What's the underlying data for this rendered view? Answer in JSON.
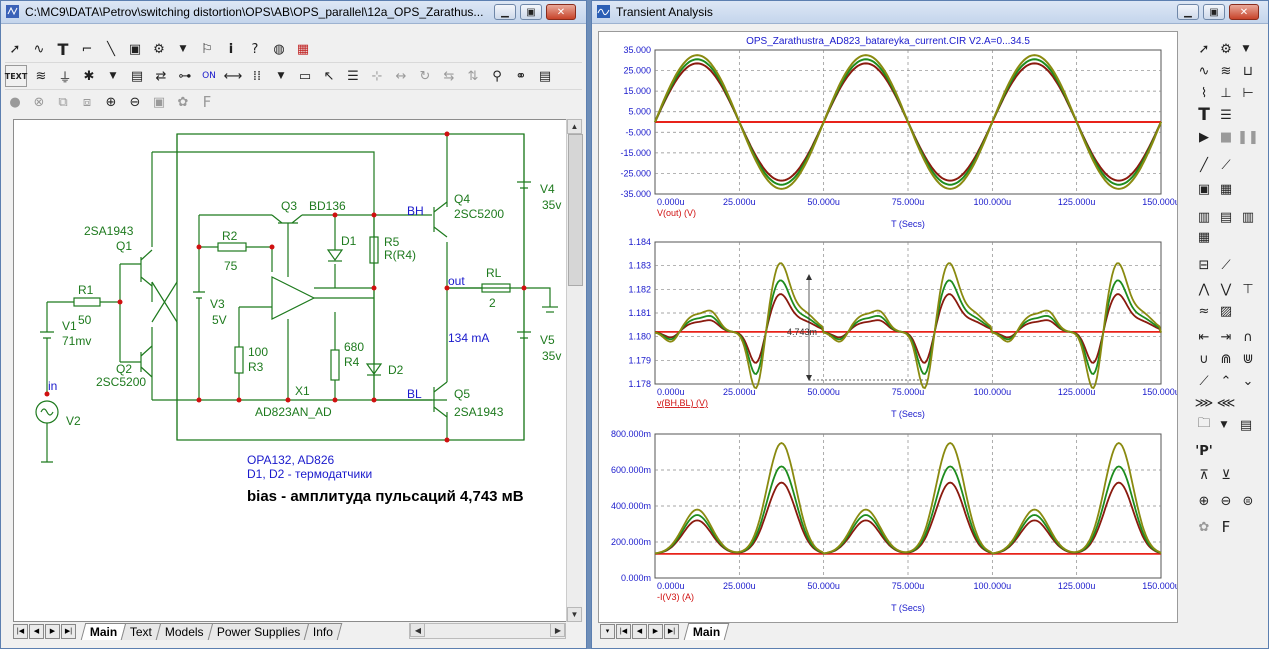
{
  "schematic_window": {
    "title": "C:\\MC9\\DATA\\Petrov\\switching distortion\\OPS\\AB\\OPS_parallel\\12a_OPS_Zarathus...",
    "toolbar1": [
      "pointer-icon",
      "wire-icon",
      "text-tool-icon",
      "ortho-wire-icon",
      "diagonal-wire-icon",
      "flag-icon",
      "component-select-icon",
      "dropdown-icon",
      "pin-icon",
      "info-icon",
      "help-icon",
      "globe-icon",
      "clear-icon"
    ],
    "toolbar2": [
      "text-icon"
    ],
    "tabs": [
      "Main",
      "Text",
      "Models",
      "Power Supplies",
      "Info"
    ],
    "active_tab": "Main"
  },
  "schematic": {
    "labels": {
      "q1_type": "2SA1943",
      "q1": "Q1",
      "r1": "R1",
      "r1_val": "50",
      "v1": "V1",
      "v1_val": "71mv",
      "q2": "Q2",
      "q2_type": "2SC5200",
      "in": "in",
      "v2": "V2",
      "q3": "Q3",
      "q3_type": "BD136",
      "r2": "R2",
      "r2_val": "75",
      "v3": "V3",
      "v3_val": "5V",
      "r3_val": "100",
      "r3": "R3",
      "x1": "X1",
      "x1_type": "AD823AN_AD",
      "d1": "D1",
      "r5": "R5",
      "r5_val": "R(R4)",
      "r4_val": "680",
      "r4": "R4",
      "d2": "D2",
      "bh": "BH",
      "q4": "Q4",
      "q4_type": "2SC5200",
      "v4": "V4",
      "v4_val": "35v",
      "out": "out",
      "rl": "RL",
      "rl_val": "2",
      "current": "134 mA",
      "v5": "V5",
      "v5_val": "35v",
      "bl": "BL",
      "q5": "Q5",
      "q5_type": "2SA1943",
      "note1": "OPA132, AD826",
      "note2": "D1, D2 - термодатчики",
      "bias": "bias - амплитуда пульсаций 4,743 мВ"
    }
  },
  "analysis_window": {
    "title": "Transient Analysis",
    "plot_title": "OPS_Zarathustra_AD823_batareyka_current.CIR V2.A=0...34.5",
    "tabs": [
      "Main"
    ]
  },
  "colors": {
    "red": "#e8231a",
    "darkred": "#8a1a0e",
    "green": "#1e8c1e",
    "olive": "#8a8a10",
    "wire": "#1e7a1e",
    "node": "#d01010",
    "label": "#1a1acc"
  },
  "chart_data": [
    {
      "type": "line",
      "title": "OPS_Zarathustra_AD823_batareyka_current.CIR V2.A=0...34.5",
      "ylabel": "V(out) (V)",
      "xlabel": "T (Secs)",
      "xlim": [
        0,
        150
      ],
      "ylim": [
        -35,
        35
      ],
      "xticks": [
        "0.000u",
        "25.000u",
        "50.000u",
        "75.000u",
        "100.000u",
        "125.000u",
        "150.000u"
      ],
      "yticks": [
        "35.000",
        "25.000",
        "15.000",
        "5.000",
        "-5.000",
        "-15.000",
        "-25.000",
        "-35.000"
      ],
      "series": [
        {
          "values_desc": "flat",
          "amplitude": 0,
          "color": "red"
        },
        {
          "amplitude": 28.5,
          "color": "darkred"
        },
        {
          "amplitude": 30.5,
          "color": "green"
        },
        {
          "amplitude": 32.5,
          "color": "olive"
        }
      ]
    },
    {
      "type": "line",
      "ylabel": "v(BH,BL) (V)",
      "xlabel": "T (Secs)",
      "xlim": [
        0,
        150
      ],
      "ylim": [
        1.178,
        1.184
      ],
      "xticks": [
        "0.000u",
        "25.000u",
        "50.000u",
        "75.000u",
        "100.000u",
        "125.000u",
        "150.000u"
      ],
      "yticks": [
        "1.184",
        "1.183",
        "1.182",
        "1.181",
        "1.180",
        "1.179",
        "1.178"
      ],
      "annotation": "4.743m",
      "series": [
        {
          "base": 1.1802,
          "scale": 0,
          "color": "red"
        },
        {
          "base": 1.1802,
          "scale": 0.55,
          "color": "darkred"
        },
        {
          "base": 1.1802,
          "scale": 0.75,
          "color": "green"
        },
        {
          "base": 1.1802,
          "scale": 1.0,
          "color": "olive"
        }
      ]
    },
    {
      "type": "line",
      "ylabel": "-I(V3) (A)",
      "xlabel": "T (Secs)",
      "xlim": [
        0,
        150
      ],
      "ylim": [
        0,
        0.8
      ],
      "xticks": [
        "0.000u",
        "25.000u",
        "50.000u",
        "75.000u",
        "100.000u",
        "125.000u",
        "150.000u"
      ],
      "yticks": [
        "800.000m",
        "600.000m",
        "400.000m",
        "200.000m",
        "0.000m"
      ],
      "series": [
        {
          "base": 0.134,
          "big": 0,
          "small": 0,
          "color": "red"
        },
        {
          "base": 0.134,
          "big": 0.53,
          "small": 0.32,
          "color": "darkred"
        },
        {
          "base": 0.134,
          "big": 0.62,
          "small": 0.35,
          "color": "green"
        },
        {
          "base": 0.134,
          "big": 0.75,
          "small": 0.38,
          "color": "olive"
        }
      ]
    }
  ]
}
